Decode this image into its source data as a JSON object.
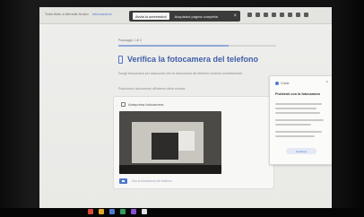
{
  "browser": {
    "top_left_text": "Tutto finito a Mensile Amico",
    "top_left_link": "Informazioni",
    "capture_pill": {
      "primary_label": "Avvia lo screenshot",
      "secondary_label": "Acquisisci pagina completa",
      "close_glyph": "×"
    }
  },
  "wizard": {
    "step_label": "Passaggio 1 di 3",
    "progress": 0.7,
    "title": "Verifica la fotocamera del telefono",
    "description": "Scegli fotocamera per assicurarti che la fotocamera del telefono funzioni correttamente.",
    "hint": "Posiziona il documento all'interno della cornice."
  },
  "camera_card": {
    "title": "Anteprima fotocamera",
    "button_text": "Usa la fotocamera del telefono"
  },
  "side_panel": {
    "header": "Guida",
    "close_glyph": "×",
    "subtitle": "Problemi con la fotocamera",
    "button_label": "Continua"
  },
  "colors": {
    "accent": "#4f78d0",
    "title_blue": "#3f5faa",
    "taskbar_apps": [
      "#d94a3a",
      "#e6a82b",
      "#4f78d0",
      "#2f9d5b",
      "#8a4fd0",
      "#e0e0e0"
    ]
  },
  "icons": {
    "phone": "phone-icon",
    "camera": "camera-icon",
    "help": "help-icon"
  }
}
